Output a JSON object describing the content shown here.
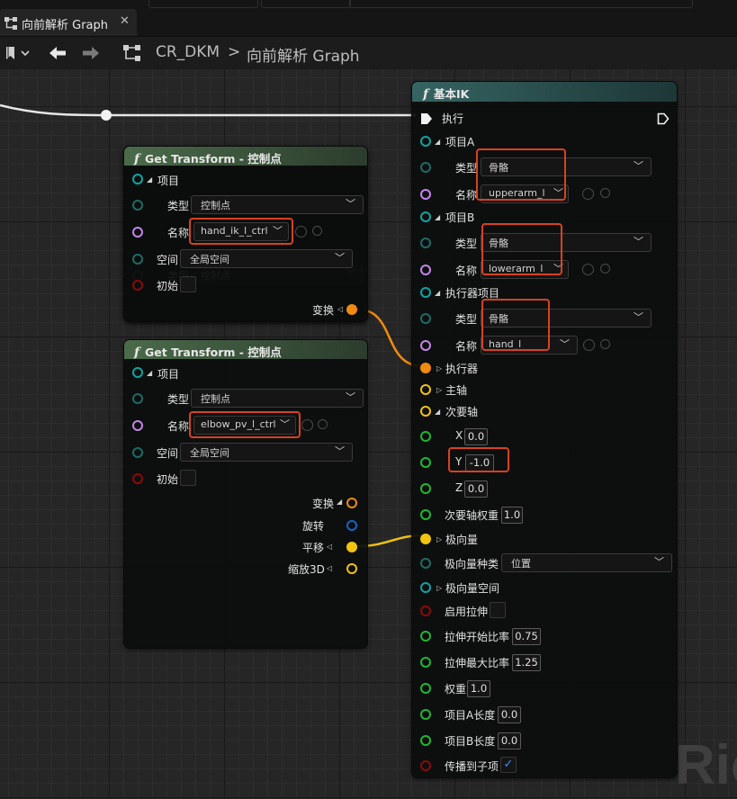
{
  "tab": {
    "title": "向前解析 Graph",
    "close": "✕"
  },
  "toolbar": {
    "crumb_root": "CR_DKM",
    "separator": ">",
    "crumb_graph": "向前解析 Graph"
  },
  "watermark": "Ric",
  "node1": {
    "title": "Get Transform - 控制点",
    "item_label": "项目",
    "type_label": "类型",
    "type_value": "控制点",
    "name_label": "名称",
    "name_value": "hand_ik_l_ctrl",
    "space_label": "空间",
    "space_value": "全局空间",
    "initial_label": "初始",
    "transform_label": "变换"
  },
  "node2": {
    "title": "Get Transform - 控制点",
    "item_label": "项目",
    "type_label": "类型",
    "type_value": "控制点",
    "name_label": "名称",
    "name_value": "elbow_pv_l_ctrl",
    "space_label": "空间",
    "space_value": "全局空间",
    "initial_label": "初始",
    "transform_label": "变换",
    "rotation_label": "旋转",
    "translation_label": "平移",
    "scale_label": "缩放3D"
  },
  "ik": {
    "title": "基本IK",
    "execute_label": "执行",
    "itemA_label": "项目A",
    "itemA_type_label": "类型",
    "itemA_type_value": "骨骼",
    "itemA_name_label": "名称",
    "itemA_name_value": "upperarm_l",
    "itemB_label": "项目B",
    "itemB_type_label": "类型",
    "itemB_type_value": "骨骼",
    "itemB_name_label": "名称",
    "itemB_name_value": "lowerarm_l",
    "effector_item_label": "执行器项目",
    "eff_type_label": "类型",
    "eff_type_value": "骨骼",
    "eff_name_label": "名称",
    "eff_name_value": "hand_l",
    "effector_label": "执行器",
    "primary_axis_label": "主轴",
    "secondary_axis_label": "次要轴",
    "x_label": "X",
    "x_value": "0.0",
    "y_label": "Y",
    "y_value": "-1.0",
    "z_label": "Z",
    "z_value": "0.0",
    "secondary_weight_label": "次要轴权重",
    "secondary_weight_value": "1.0",
    "pole_vector_label": "极向量",
    "pole_kind_label": "极向量种类",
    "pole_kind_value": "位置",
    "pole_space_label": "极向量空间",
    "enable_stretch_label": "启用拉伸",
    "stretch_start_label": "拉伸开始比率",
    "stretch_start_value": "0.75",
    "stretch_max_label": "拉伸最大比率",
    "stretch_max_value": "1.25",
    "weight_label": "权重",
    "weight_value": "1.0",
    "itemA_length_label": "项目A长度",
    "itemA_length_value": "0.0",
    "itemB_length_label": "项目B长度",
    "itemB_length_value": "0.0",
    "propagate_label": "传播到子项",
    "propagate_checked": "✓"
  },
  "colors": {
    "accent_highlight": "#d8421f",
    "ik_header": "#2f5a58",
    "get_header": "#3c5a3e"
  }
}
